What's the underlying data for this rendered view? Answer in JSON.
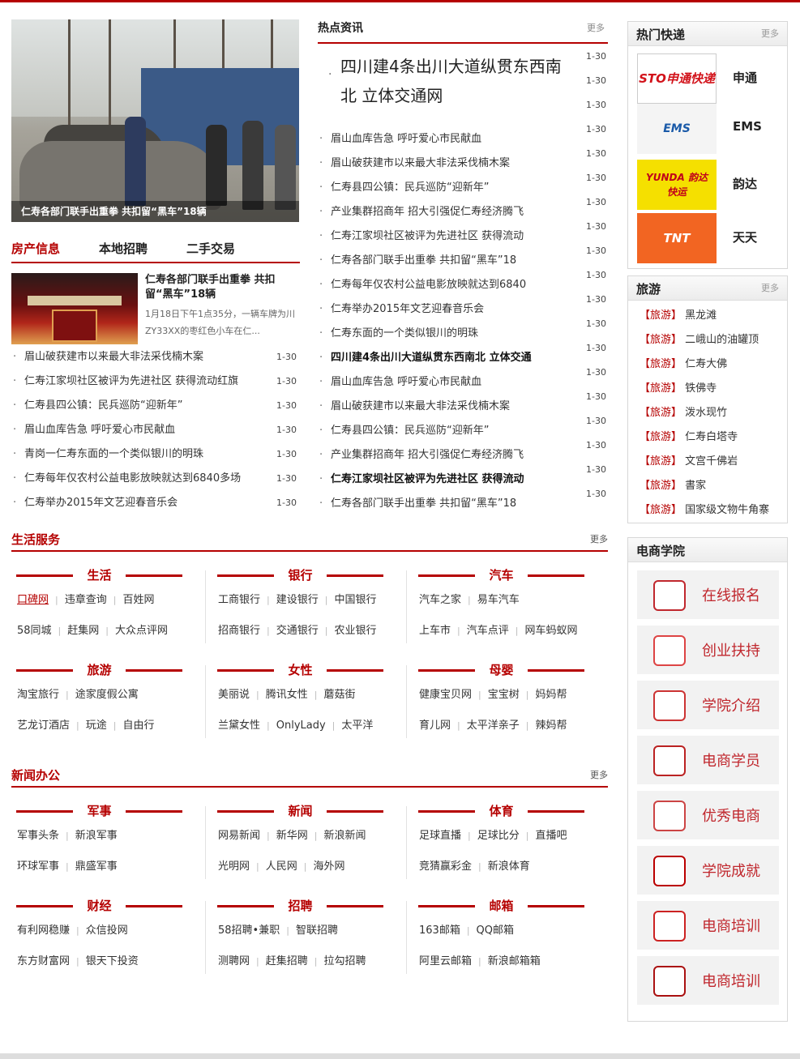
{
  "photo_caption": "仁寿各部门联手出重拳 共扣留“黑车”18辆",
  "tabs": [
    "房产信息",
    "本地招聘",
    "二手交易"
  ],
  "feature": {
    "title": "仁寿各部门联手出重拳 共扣留“黑车”18辆",
    "desc": "1月18日下午1点35分，一辆车牌为川ZY33XX的枣红色小车在仁..."
  },
  "left_list": [
    {
      "t": "眉山破获建市以来最大非法采伐楠木案",
      "d": "1-30"
    },
    {
      "t": "仁寿江家坝社区被评为先进社区 获得流动红旗",
      "d": "1-30"
    },
    {
      "t": "仁寿县四公镇：民兵巡防“迎新年”",
      "d": "1-30"
    },
    {
      "t": "眉山血库告急 呼吁爱心市民献血",
      "d": "1-30"
    },
    {
      "t": "青岗一仁寿东面的一个类似银川的明珠",
      "d": "1-30"
    },
    {
      "t": "仁寿每年仅农村公益电影放映就达到6840多场",
      "d": "1-30"
    },
    {
      "t": "仁寿举办2015年文艺迎春音乐会",
      "d": "1-30"
    }
  ],
  "hot": {
    "title": "热点资讯",
    "more": "更多",
    "headline": "四川建4条出川大道纵贯东西南北 立体交通网",
    "dates": [
      "1-30",
      "1-30",
      "1-30",
      "1-30",
      "1-30",
      "1-30",
      "1-30",
      "1-30",
      "1-30",
      "1-30",
      "1-30",
      "1-30",
      "1-30",
      "1-30",
      "1-30",
      "1-30",
      "1-30",
      "1-30",
      "1-30"
    ],
    "items": [
      {
        "t": "眉山血库告急 呼吁爱心市民献血",
        "b": false
      },
      {
        "t": "眉山破获建市以来最大非法采伐楠木案",
        "b": false
      },
      {
        "t": "仁寿县四公镇：民兵巡防“迎新年”",
        "b": false
      },
      {
        "t": "产业集群招商年 招大引强促仁寿经济腾飞",
        "b": false
      },
      {
        "t": "仁寿江家坝社区被评为先进社区 获得流动",
        "b": false
      },
      {
        "t": "仁寿各部门联手出重拳 共扣留“黑车”18",
        "b": false
      },
      {
        "t": "仁寿每年仅农村公益电影放映就达到6840",
        "b": false
      },
      {
        "t": "仁寿举办2015年文艺迎春音乐会",
        "b": false
      },
      {
        "t": "仁寿东面的一个类似银川的明珠",
        "b": false
      },
      {
        "t": "四川建4条出川大道纵贯东西南北 立体交通",
        "b": true
      },
      {
        "t": "眉山血库告急 呼吁爱心市民献血",
        "b": false
      },
      {
        "t": "眉山破获建市以来最大非法采伐楠木案",
        "b": false
      },
      {
        "t": "仁寿县四公镇：民兵巡防“迎新年”",
        "b": false
      },
      {
        "t": "产业集群招商年 招大引强促仁寿经济腾飞",
        "b": false
      },
      {
        "t": "仁寿江家坝社区被评为先进社区 获得流动",
        "b": true
      },
      {
        "t": "仁寿各部门联手出重拳 共扣留“黑车”18",
        "b": false
      }
    ]
  },
  "express": {
    "title": "热门快递",
    "more": "更多",
    "items": [
      {
        "logo": "STO申通快递",
        "name": "申通"
      },
      {
        "logo": "EMS",
        "name": "EMS"
      },
      {
        "logo": "YUNDA 韵达快运",
        "name": "韵达"
      },
      {
        "logo": "TNT",
        "name": "天天"
      }
    ]
  },
  "travel": {
    "title": "旅游",
    "more": "更多",
    "tag": "【旅游】",
    "items": [
      "黑龙滩",
      "二峨山的油罐顶",
      "仁寿大佛",
      "铁佛寺",
      "泼水现竹",
      "仁寿白塔寺",
      "文宫千佛岩",
      "書家",
      "国家级文物牛角寨"
    ]
  },
  "ecom": {
    "title": "电商学院",
    "items": [
      "在线报名",
      "创业扶持",
      "学院介绍",
      "电商学员",
      "优秀电商",
      "学院成就",
      "电商培训",
      "电商培训"
    ]
  },
  "life": {
    "title": "生活服务",
    "more": "更多",
    "cats": [
      {
        "name": "生活",
        "rows": [
          [
            "口碑网",
            "违章查询",
            "百姓网"
          ],
          [
            "58同城",
            "赶集网",
            "大众点评网"
          ]
        ]
      },
      {
        "name": "银行",
        "rows": [
          [
            "工商银行",
            "建设银行",
            "中国银行"
          ],
          [
            "招商银行",
            "交通银行",
            "农业银行"
          ]
        ]
      },
      {
        "name": "汽车",
        "rows": [
          [
            "汽车之家",
            "易车汽车"
          ],
          [
            "上车市",
            "汽车点评",
            "网车蚂蚁网"
          ]
        ]
      },
      {
        "name": "旅游",
        "rows": [
          [
            "淘宝旅行",
            "途家度假公寓"
          ],
          [
            "艺龙订酒店",
            "玩途",
            "自由行"
          ]
        ]
      },
      {
        "name": "女性",
        "rows": [
          [
            "美丽说",
            "腾讯女性",
            "蘑菇街"
          ],
          [
            "兰黛女性",
            "OnlyLady",
            "太平洋"
          ]
        ]
      },
      {
        "name": "母婴",
        "rows": [
          [
            "健康宝贝网",
            "宝宝树",
            "妈妈帮"
          ],
          [
            "育儿网",
            "太平洋亲子",
            "辣妈帮"
          ]
        ]
      }
    ]
  },
  "news": {
    "title": "新闻办公",
    "more": "更多",
    "cats": [
      {
        "name": "军事",
        "rows": [
          [
            "军事头条",
            "新浪军事"
          ],
          [
            "环球军事",
            "鼎盛军事"
          ]
        ]
      },
      {
        "name": "新闻",
        "rows": [
          [
            "网易新闻",
            "新华网",
            "新浪新闻"
          ],
          [
            "光明网",
            "人民网",
            "海外网"
          ]
        ]
      },
      {
        "name": "体育",
        "rows": [
          [
            "足球直播",
            "足球比分",
            "直播吧"
          ],
          [
            "竞猜赢彩金",
            "新浪体育"
          ]
        ]
      },
      {
        "name": "财经",
        "rows": [
          [
            "有利网稳赚",
            "众信投网"
          ],
          [
            "东方财富网",
            "银天下投资"
          ]
        ]
      },
      {
        "name": "招聘",
        "rows": [
          [
            "58招聘•兼职",
            "智联招聘"
          ],
          [
            "测聘网",
            "赶集招聘",
            "拉勾招聘"
          ]
        ]
      },
      {
        "name": "邮箱",
        "rows": [
          [
            "163邮箱",
            "QQ邮箱"
          ],
          [
            "阿里云邮箱",
            "新浪邮箱箱"
          ]
        ]
      }
    ]
  },
  "colors": {
    "accent": "#b50000",
    "express_sto": "#d2121a",
    "express_yunda": "#f5e000",
    "express_tnt": "#f26522"
  }
}
